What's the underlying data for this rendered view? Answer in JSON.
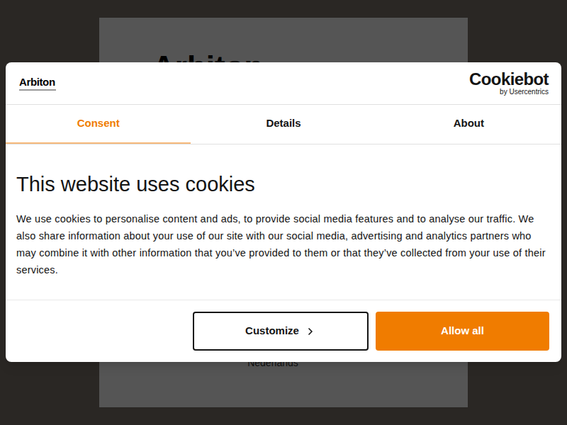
{
  "background": {
    "heading": "Arbiton",
    "language": "Nederlands"
  },
  "dialog": {
    "brand": "Arbiton",
    "provider": {
      "name": "Cookiebot",
      "byline": "by Usercentrics"
    },
    "tabs": [
      {
        "label": "Consent",
        "selected": true
      },
      {
        "label": "Details",
        "selected": false
      },
      {
        "label": "About",
        "selected": false
      }
    ],
    "title": "This website uses cookies",
    "body": "We use cookies to personalise content and ads, to provide social media features and to analyse our traffic. We also share information about your use of our site with our social media, advertising and analytics partners who may combine it with other information that you’ve provided to them or that they’ve collected from your use of their services.",
    "buttons": [
      {
        "label": "Customize",
        "kind": "outline"
      },
      {
        "label": "Allow all",
        "kind": "primary"
      }
    ]
  }
}
